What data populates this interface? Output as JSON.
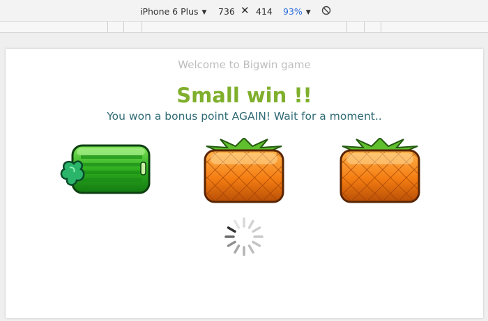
{
  "toolbar": {
    "device": "iPhone 6 Plus",
    "width": "736",
    "height": "414",
    "times_symbol": "✕",
    "zoom": "93%",
    "rotate_icon": "rotate-icon"
  },
  "page": {
    "welcome": "Welcome to Bigwin game",
    "result_title": "Small win !!",
    "result_subtitle": "You won a bonus point AGAIN! Wait for a moment.."
  },
  "reels": [
    {
      "symbol": "watermelon",
      "icon": "watermelon-icon"
    },
    {
      "symbol": "pineapple",
      "icon": "pineapple-icon"
    },
    {
      "symbol": "pineapple",
      "icon": "pineapple-icon"
    }
  ],
  "colors": {
    "title_green": "#7faf2c",
    "subtitle_teal": "#2f6a74",
    "zoom_blue": "#2a6edb"
  }
}
